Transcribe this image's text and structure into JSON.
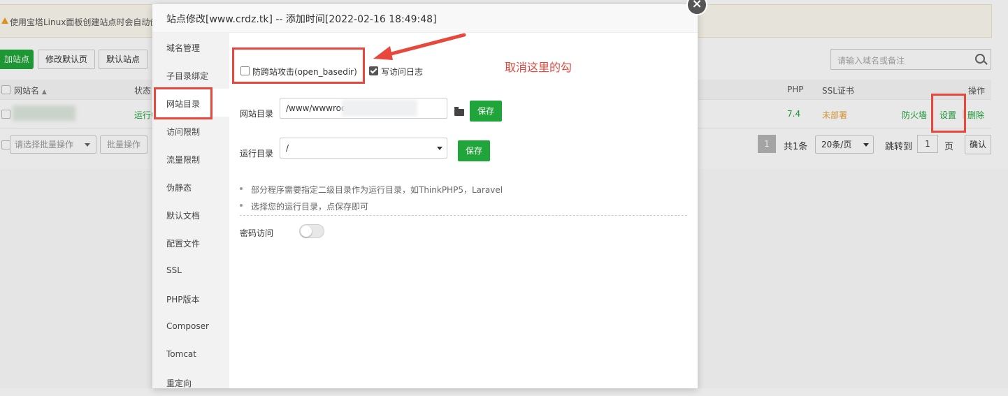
{
  "background": {
    "notice_text": "使用宝塔Linux面板创建站点时会自动创",
    "toolbar": {
      "add_site": "加站点",
      "modify_default_page": "修改默认页",
      "default_site": "默认站点"
    },
    "search_placeholder": "请输入域名或备注",
    "table_headers": {
      "site_name": "网站名",
      "status": "状态",
      "php": "PHP",
      "ssl": "SSL证书",
      "actions": "操作"
    },
    "row": {
      "status": "运行中",
      "php": "7.4",
      "ssl": "未部署",
      "firewall": "防火墙",
      "settings": "设置",
      "delete": "删除"
    },
    "batch": {
      "select_placeholder": "请选择批量操作",
      "batch_button": "批量操作"
    },
    "pager": {
      "current_page": "1",
      "total": "共1条",
      "per_page": "20条/页",
      "jump_to": "跳转到",
      "jump_value": "1",
      "page_unit": "页",
      "confirm": "确认"
    }
  },
  "modal": {
    "title": "站点修改[www.crdz.tk] -- 添加时间[2022-02-16 18:49:48]",
    "close_glyph": "×",
    "menu": [
      "域名管理",
      "子目录绑定",
      "网站目录",
      "访问限制",
      "流量限制",
      "伪静态",
      "默认文档",
      "配置文件",
      "SSL",
      "PHP版本",
      "Composer",
      "Tomcat",
      "重定向"
    ],
    "active_menu_index": 2,
    "anti_xss_label": "防跨站攻击(open_basedir)",
    "anti_xss_checked": false,
    "access_log_label": "写访问日志",
    "access_log_checked": true,
    "site_dir_label": "网站目录",
    "site_dir_value": "/www/wwwroo",
    "save_label": "保存",
    "run_dir_label": "运行目录",
    "run_dir_value": "/",
    "tips": [
      "部分程序需要指定二级目录作为运行目录，如ThinkPHP5，Laravel",
      "选择您的运行目录，点保存即可"
    ],
    "password_access_label": "密码访问",
    "password_access_on": false
  },
  "annotation": {
    "text": "取消这里的勾",
    "color": "#e8473c"
  },
  "colors": {
    "accent": "#20a53a",
    "warning": "#e6a23c",
    "annotation": "#e8473c"
  }
}
